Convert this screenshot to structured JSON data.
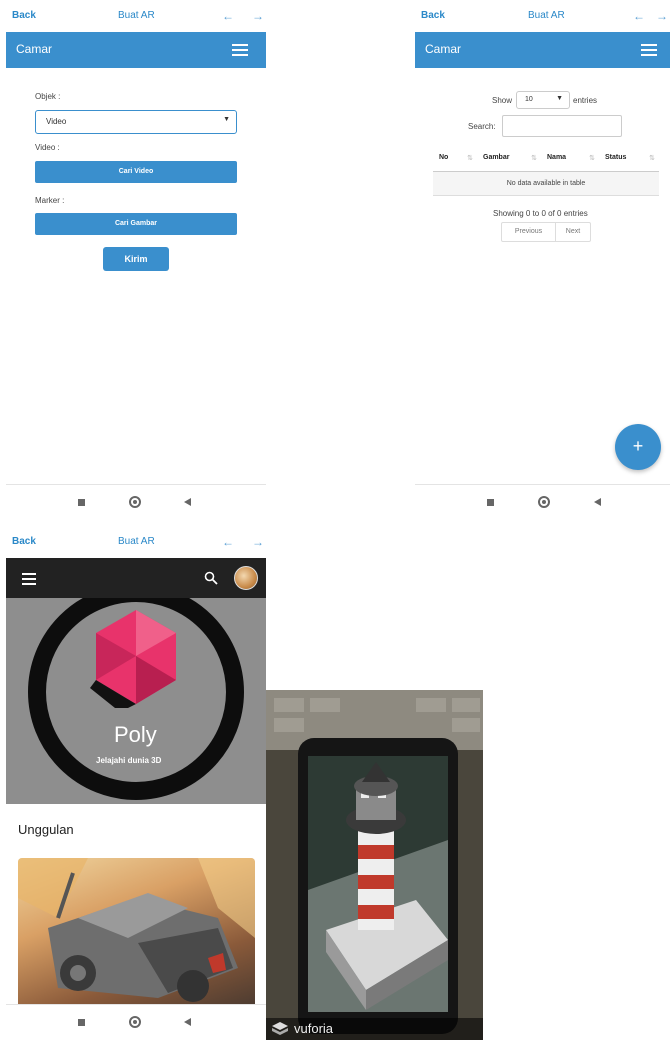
{
  "screen1": {
    "nav": {
      "back": "Back",
      "title": "Buat AR",
      "left_arrow": "←",
      "right_arrow": "→"
    },
    "appbar_title": "Camar",
    "objek_label": "Objek :",
    "objek_value": "Video",
    "video_label": "Video :",
    "cari_video": "Cari Video",
    "marker_label": "Marker :",
    "cari_gambar": "Cari Gambar",
    "submit": "Kirim"
  },
  "screen2": {
    "nav": {
      "back": "Back",
      "title": "Buat AR",
      "left_arrow": "←",
      "right_arrow": "→"
    },
    "appbar_title": "Camar",
    "show_label": "Show",
    "entries_value": "10",
    "entries_label": "entries",
    "search_label": "Search:",
    "columns": [
      "No",
      "Gambar",
      "Nama",
      "Status"
    ],
    "empty_message": "No data available in table",
    "info": "Showing 0 to 0 of 0 entries",
    "prev": "Previous",
    "next": "Next",
    "fab": "+"
  },
  "screen3": {
    "nav": {
      "back": "Back",
      "title": "Buat AR",
      "left_arrow": "←",
      "right_arrow": "→"
    },
    "app_name": "Poly",
    "tagline": "Jelajahi dunia 3D",
    "section_title": "Unggulan"
  },
  "screen4": {
    "brand": "vuforia"
  },
  "icons": [
    "menu-icon",
    "search-icon",
    "home-icon",
    "back-icon",
    "recents-icon",
    "add-icon"
  ],
  "colors": {
    "accent": "#3a8fcd",
    "poly_dark": "#222222",
    "poly_pink": "#e8336b"
  }
}
